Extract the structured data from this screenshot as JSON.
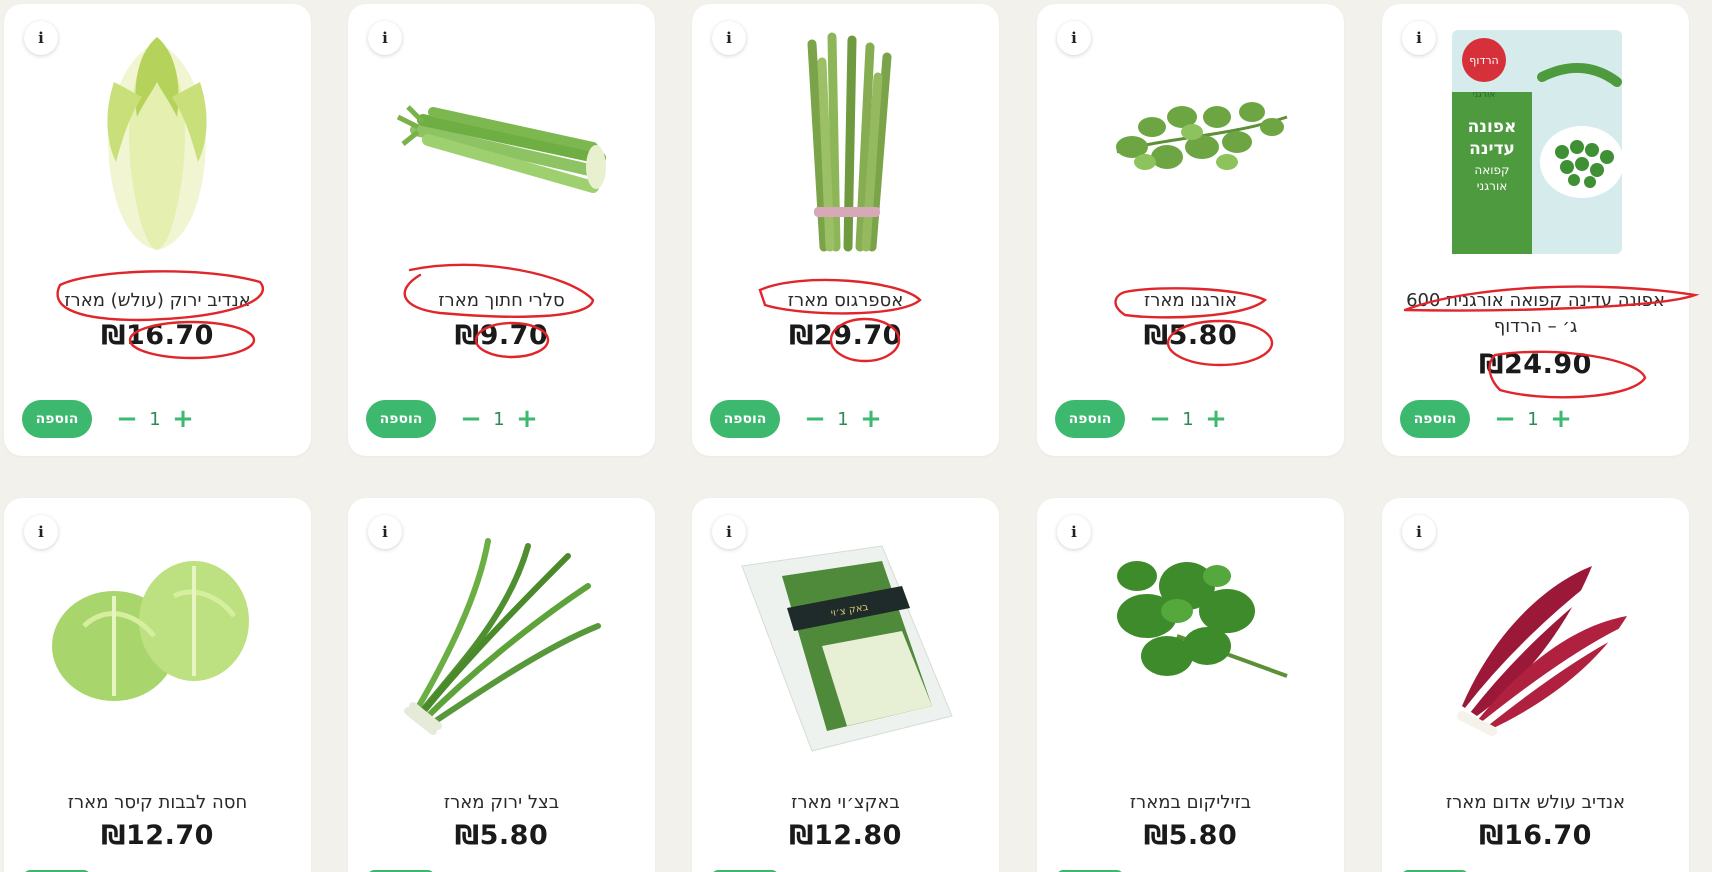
{
  "currency": "₪",
  "products": [
    {
      "name": "אנדיב ירוק (עולש) מארז",
      "price": "16.70",
      "qty": "1",
      "add_label": "הוספה",
      "info": "i",
      "icon": "endive-image"
    },
    {
      "name": "סלרי חתוך מארז",
      "price": "9.70",
      "qty": "1",
      "add_label": "הוספה",
      "info": "i",
      "icon": "celery-image"
    },
    {
      "name": "אספרגוס מארז",
      "price": "29.70",
      "qty": "1",
      "add_label": "הוספה",
      "info": "i",
      "icon": "asparagus-image"
    },
    {
      "name": "אורגנו מארז",
      "price": "5.80",
      "qty": "1",
      "add_label": "הוספה",
      "info": "i",
      "icon": "oregano-image"
    },
    {
      "name": "אפונה עדינה קפואה אורגנית 600 ג׳ – הרדוף",
      "price": "24.90",
      "qty": "1",
      "add_label": "הוספה",
      "info": "i",
      "icon": "frozen-peas-image",
      "package": {
        "brand": "הרדוף",
        "sub": "אורגני",
        "title1": "אפונה",
        "title2": "עדינה",
        "line1": "קפואה",
        "line2": "אורגני"
      }
    },
    {
      "name": "חסה לבבות קיסר מארז",
      "price": "12.70",
      "info": "i",
      "icon": "lettuce-image"
    },
    {
      "name": "בצל ירוק מארז",
      "price": "5.80",
      "info": "i",
      "icon": "green-onion-image"
    },
    {
      "name": "באקצ׳וי מארז",
      "price": "12.80",
      "info": "i",
      "icon": "bok-choy-image",
      "package_label": "באק צ׳וי"
    },
    {
      "name": "בזיליקום במארז",
      "price": "5.80",
      "info": "i",
      "icon": "basil-image"
    },
    {
      "name": "אנדיב עולש אדום מארז",
      "price": "16.70",
      "info": "i",
      "icon": "radicchio-image"
    }
  ],
  "colors": {
    "accent": "#3db86f",
    "annotation": "#e0262a",
    "background": "#f3f1ec"
  }
}
